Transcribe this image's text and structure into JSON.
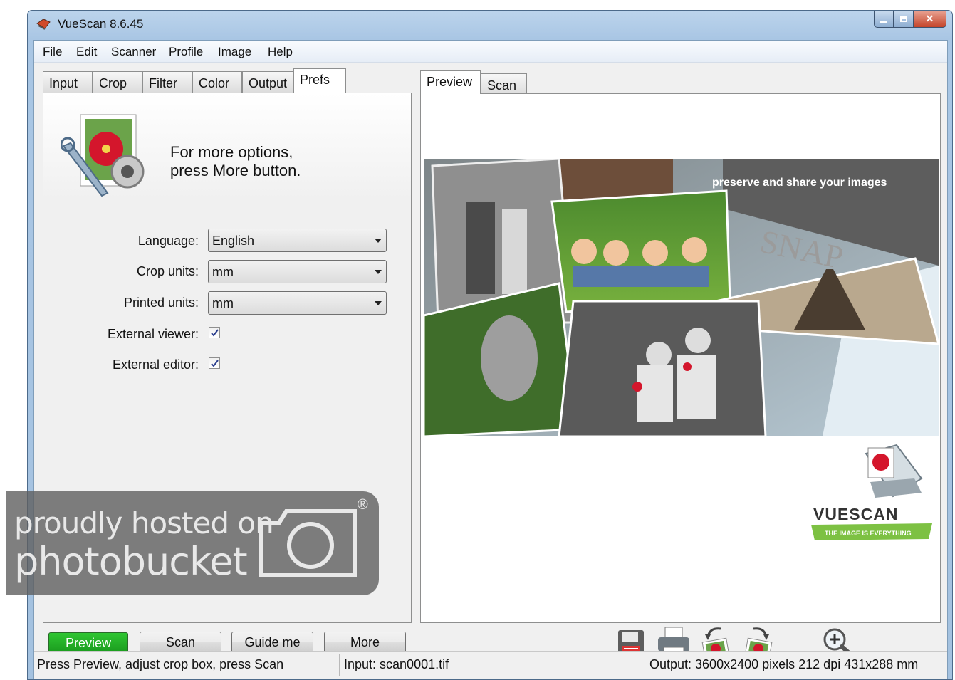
{
  "window": {
    "title": "VueScan 8.6.45"
  },
  "menu": [
    "File",
    "Edit",
    "Scanner",
    "Profile",
    "Image",
    "Help"
  ],
  "left_tabs": [
    "Input",
    "Crop",
    "Filter",
    "Color",
    "Output",
    "Prefs"
  ],
  "left_active_tab": "Prefs",
  "right_tabs": [
    "Preview",
    "Scan"
  ],
  "right_active_tab": "Preview",
  "prefs": {
    "hint_line1": "For more options,",
    "hint_line2": "press More button.",
    "language_label": "Language:",
    "language_value": "English",
    "crop_units_label": "Crop units:",
    "crop_units_value": "mm",
    "printed_units_label": "Printed units:",
    "printed_units_value": "mm",
    "external_viewer_label": "External viewer:",
    "external_viewer_checked": true,
    "external_editor_label": "External editor:",
    "external_editor_checked": true
  },
  "buttons": {
    "preview": "Preview",
    "scan": "Scan",
    "guide": "Guide me",
    "more": "More"
  },
  "preview_image": {
    "tagline": "preserve and share your images",
    "snap_text": "SNAP",
    "logo_text": "VUESCAN",
    "logo_subtext": "THE IMAGE IS EVERYTHING"
  },
  "status": {
    "hint": "Press Preview, adjust crop box, press Scan",
    "input": "Input: scan0001.tif",
    "output": "Output: 3600x2400 pixels 212 dpi 431x288 mm"
  },
  "watermark": {
    "line1": "proudly hosted on",
    "line2": "photobucket"
  },
  "colors": {
    "preview_button": "#1fa723",
    "title_bg": "#a9c6e4",
    "close_button": "#c4452b"
  },
  "toolbar_icons": [
    "save-icon",
    "print-icon",
    "rotate-left-icon",
    "rotate-right-icon",
    "zoom-in-icon"
  ]
}
